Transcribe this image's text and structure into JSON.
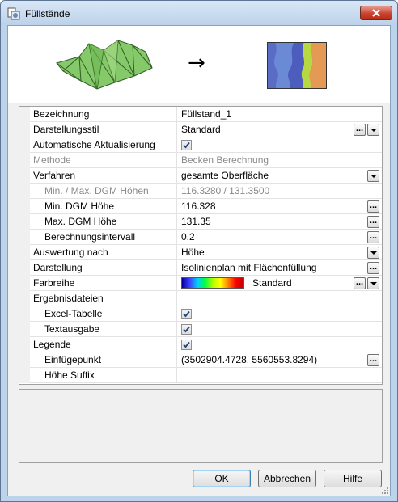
{
  "window": {
    "title": "Füllstände"
  },
  "preview": {
    "arrow": "→"
  },
  "properties": [
    {
      "name": "Bezeichnung",
      "value": "Füllstand_1"
    },
    {
      "name": "Darstellungsstil",
      "value": "Standard"
    },
    {
      "name": "Automatische Aktualisierung",
      "checked": true
    },
    {
      "name": "Methode",
      "value": "Becken Berechnung"
    },
    {
      "name": "Verfahren",
      "value": "gesamte Oberfläche"
    },
    {
      "name": "Min. / Max. DGM Höhen",
      "value": "116.3280 / 131.3500"
    },
    {
      "name": "Min. DGM Höhe",
      "value": "116.328"
    },
    {
      "name": "Max. DGM Höhe",
      "value": "131.35"
    },
    {
      "name": "Berechnungsintervall",
      "value": "0.2"
    },
    {
      "name": "Auswertung nach",
      "value": "Höhe"
    },
    {
      "name": "Darstellung",
      "value": "Isolinienplan mit Flächenfüllung"
    },
    {
      "name": "Farbreihe",
      "value": "Standard"
    },
    {
      "name": "Ergebnisdateien",
      "value": ""
    },
    {
      "name": "Excel-Tabelle",
      "checked": true
    },
    {
      "name": "Textausgabe",
      "checked": true
    },
    {
      "name": "Legende",
      "checked": true
    },
    {
      "name": "Einfügepunkt",
      "value": "(3502904.4728, 5560553.8294)"
    },
    {
      "name": "Höhe Suffix",
      "value": ""
    }
  ],
  "buttons": {
    "ok": "OK",
    "cancel": "Abbrechen",
    "help": "Hilfe"
  },
  "icons": {
    "ellipsis": "...",
    "close": "close-icon",
    "dropdown": "chevron-down-icon",
    "checkbox": "check-icon"
  }
}
